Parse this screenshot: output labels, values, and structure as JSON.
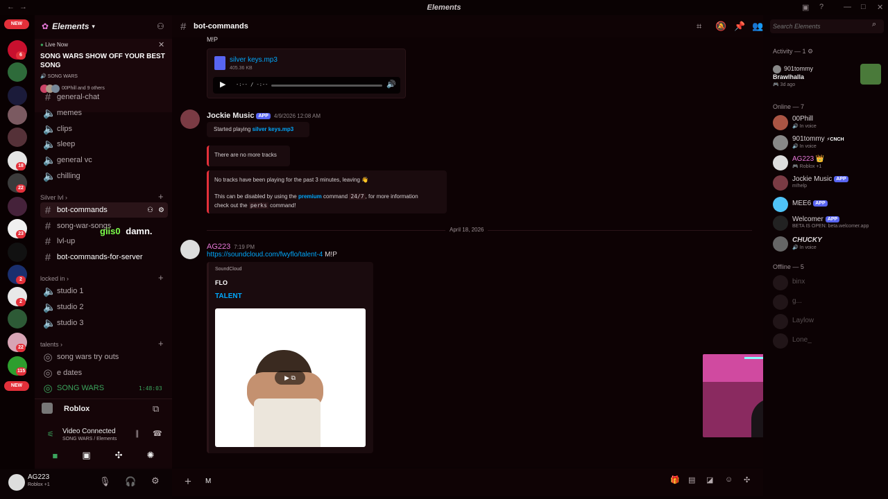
{
  "window": {
    "title": "Elements"
  },
  "servers": {
    "new_label": "NEW",
    "badges": [
      "6",
      "18",
      "22",
      "23",
      "2",
      "2",
      "22",
      "115"
    ],
    "new_bottom_label": "NEW"
  },
  "guild": {
    "name": "Elements"
  },
  "live": {
    "tag": "Live Now",
    "title": "SONG WARS SHOW OFF YOUR BEST SONG",
    "channel": "SONG WARS",
    "participants": "00Phill and 9 others"
  },
  "channels": {
    "partial": "general-chat",
    "top": [
      {
        "name": "memes",
        "type": "voice"
      },
      {
        "name": "clips",
        "type": "voice"
      },
      {
        "name": "sleep",
        "type": "voice"
      },
      {
        "name": "general vc",
        "type": "voice"
      },
      {
        "name": "chilling",
        "type": "voice"
      }
    ],
    "cat1": "Silver lvl",
    "cat1_items": [
      {
        "name": "bot-commands",
        "type": "text"
      },
      {
        "name": "song-war-songs",
        "type": "text"
      },
      {
        "name": "lvl-up",
        "type": "text"
      },
      {
        "name": "bot-commands-for-server",
        "type": "text"
      }
    ],
    "cat2": "locked in",
    "cat2_items": [
      {
        "name": "studio 1"
      },
      {
        "name": "studio 2"
      },
      {
        "name": "studio 3"
      }
    ],
    "cat3": "talents",
    "cat3_items": [
      {
        "name": "song wars try outs"
      },
      {
        "name": "e dates"
      },
      {
        "name": "SONG WARS",
        "time": "1:48:03"
      }
    ]
  },
  "overlay": {
    "user": "giis0",
    "text": "damn."
  },
  "voice": {
    "activity": "Roblox",
    "status": "Video Connected",
    "location": "SONG WARS / Elements"
  },
  "user": {
    "name": "AG223",
    "status": "Roblox +1"
  },
  "header": {
    "channel": "bot-commands",
    "search_placeholder": "Search Elements"
  },
  "messages": {
    "top_text": "M!P",
    "file": {
      "name": "silver keys.mp3",
      "size": "405.36 KB",
      "time": "-:-- / -:--"
    },
    "jockie": {
      "name": "Jockie Music",
      "tag": "APP",
      "time": "4/9/2026 12:08 AM",
      "e1_prefix": "Started playing ",
      "e1_link": "silver keys.mp3",
      "e2": "There are no more tracks",
      "e3_l1": "No tracks have been playing for the past 3 minutes, leaving 👋",
      "e3_l2a": "This can be disabled by using the ",
      "e3_l2b": "premium",
      "e3_l2c": " command ",
      "e3_l2d": "24/7",
      "e3_l2e": ", for more information",
      "e3_l3a": "check out the ",
      "e3_l3b": "perks",
      "e3_l3c": " command!"
    },
    "divider": "April 18, 2026",
    "ag": {
      "name": "AG223",
      "time": "7:19 PM",
      "link": "https://soundcloud.com/fwyflo/talent-4",
      "suffix": " M!P"
    },
    "sc": {
      "provider": "SoundCloud",
      "author": "FLO",
      "title": "TALENT"
    }
  },
  "composer": {
    "value": "M"
  },
  "members": {
    "activity_head": "Activity — 1",
    "activity": {
      "name": "901tommy",
      "game": "Brawlhalla",
      "ago": "3d ago"
    },
    "online_head": "Online — 7",
    "online": [
      {
        "name": "00Phill",
        "sub": "In voice",
        "color": "#dcd6d8"
      },
      {
        "name": "901tommy",
        "sub": "In voice",
        "color": "#dcd6d8",
        "tag": "CNCH"
      },
      {
        "name": "AG223",
        "sub": "Roblox +1",
        "color": "#e879d9"
      },
      {
        "name": "Jockie Music",
        "sub": "m!help",
        "color": "#dcd6d8",
        "app": "APP"
      },
      {
        "name": "MEE6",
        "sub": "",
        "color": "#dcd6d8",
        "app": "APP"
      },
      {
        "name": "Welcomer",
        "sub": "BETA IS OPEN: beta.welcomer.app",
        "color": "#dcd6d8",
        "app": "APP"
      },
      {
        "name": "CHUCKY",
        "sub": "In voice",
        "color": "#dcd6d8"
      }
    ],
    "offline_head": "Offline — 5",
    "offline": [
      {
        "name": "binx"
      },
      {
        "name": "g..."
      },
      {
        "name": "Laylow"
      },
      {
        "name": "Lone_"
      }
    ]
  },
  "colors": {
    "accent": "#e3303a",
    "link": "#00a8fc",
    "app": "#5865f2"
  }
}
